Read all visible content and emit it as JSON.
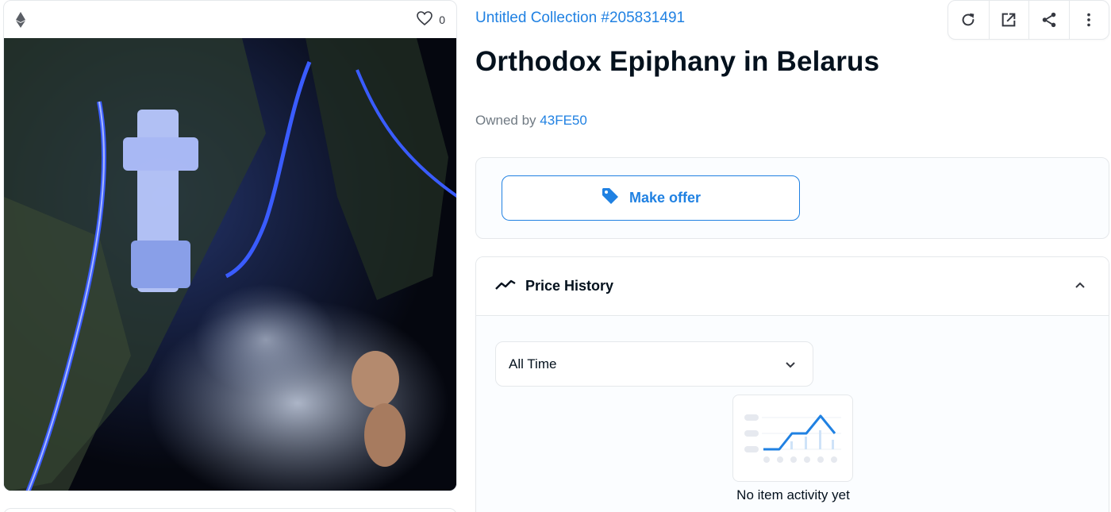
{
  "asset_card": {
    "chain_icon": "ethereum-icon",
    "favorite_icon": "heart-icon",
    "favorite_count": "0",
    "image_subject": "cross-of-ice-splash-photo"
  },
  "collection": {
    "name": "Untitled Collection #205831491"
  },
  "toolbar": {
    "icons": [
      "refresh-icon",
      "external-link-icon",
      "share-icon",
      "more-vertical-icon"
    ]
  },
  "item": {
    "title": "Orthodox Epiphany in Belarus",
    "owned_by_label": "Owned by",
    "owner": "43FE50"
  },
  "offer": {
    "icon": "tag-icon",
    "button_label": "Make offer"
  },
  "price_history": {
    "icon": "trend-line-icon",
    "title": "Price History",
    "collapse_icon": "chevron-up-icon",
    "range": {
      "selected": "All Time",
      "icon": "chevron-down-icon"
    },
    "empty_icon": "chart-placeholder-icon",
    "empty_text": "No item activity yet"
  },
  "colors": {
    "accent": "#2081e2",
    "text": "#04111d",
    "muted": "#707a83",
    "border": "#e5e8eb"
  }
}
